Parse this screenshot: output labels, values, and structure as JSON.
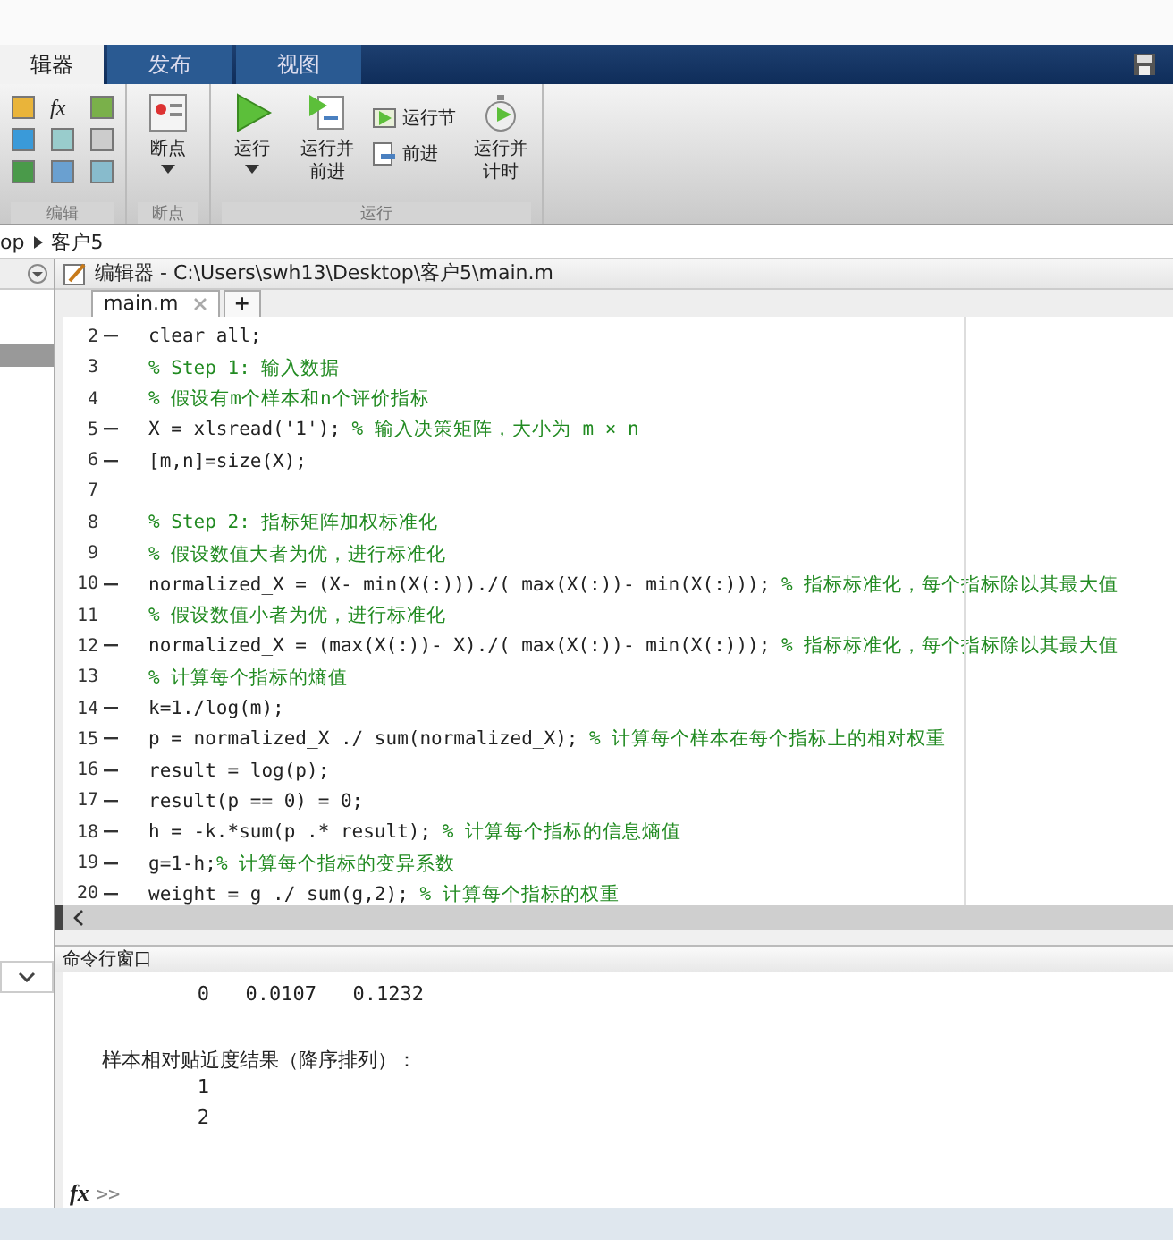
{
  "tabs": [
    {
      "label": "辑器",
      "selected": true
    },
    {
      "label": "发布",
      "selected": false
    },
    {
      "label": "视图",
      "selected": false
    }
  ],
  "ribbon": {
    "groups": [
      {
        "label": "编辑",
        "kind": "icons",
        "glyph": "fx"
      },
      {
        "label": "断点",
        "kind": "buttons",
        "items": [
          {
            "kind": "large",
            "label": "断点",
            "dropdown": true
          }
        ]
      },
      {
        "label": "运行",
        "kind": "buttons",
        "items": [
          {
            "kind": "large",
            "label": "运行",
            "dropdown": true
          },
          {
            "kind": "large",
            "label": "运行并前进",
            "dropdown": false
          },
          {
            "kind": "stack",
            "items": [
              {
                "label": "运行节"
              },
              {
                "label": "前进"
              }
            ]
          },
          {
            "kind": "large",
            "label": "运行并计时",
            "dropdown": false
          }
        ]
      }
    ]
  },
  "breadcrumb": [
    "op",
    "客户5"
  ],
  "editor": {
    "title": "编辑器 - C:\\Users\\swh13\\Desktop\\客户5\\main.m",
    "file_tabs": [
      {
        "label": "main.m",
        "selected": true
      }
    ],
    "add_tab": "+",
    "lines": [
      {
        "number": "2",
        "executable": true,
        "code": "clear all;"
      },
      {
        "number": "3",
        "executable": false,
        "comment": "% Step 1: 输入数据"
      },
      {
        "number": "4",
        "executable": false,
        "comment": "% 假设有m个样本和n个评价指标"
      },
      {
        "number": "5",
        "executable": true,
        "code": "X = xlsread('1'); ",
        "comment": "% 输入决策矩阵，大小为 m × n"
      },
      {
        "number": "6",
        "executable": true,
        "code": "[m,n]=size(X);"
      },
      {
        "number": "7",
        "executable": false
      },
      {
        "number": "8",
        "executable": false,
        "comment": "% Step 2: 指标矩阵加权标准化"
      },
      {
        "number": "9",
        "executable": false,
        "comment": "% 假设数值大者为优，进行标准化"
      },
      {
        "number": "10",
        "executable": true,
        "code": "normalized_X = (X- min(X(:)))./( max(X(:))- min(X(:))); ",
        "comment": "% 指标标准化，每个指标除以其最大值"
      },
      {
        "number": "11",
        "executable": false,
        "comment": "% 假设数值小者为优，进行标准化"
      },
      {
        "number": "12",
        "executable": true,
        "code": "normalized_X = (max(X(:))- X)./( max(X(:))- min(X(:))); ",
        "comment": "% 指标标准化，每个指标除以其最大值"
      },
      {
        "number": "13",
        "executable": false,
        "comment": "% 计算每个指标的熵值"
      },
      {
        "number": "14",
        "executable": true,
        "code": "k=1./log(m);"
      },
      {
        "number": "15",
        "executable": true,
        "code": "p = normalized_X ./ sum(normalized_X); ",
        "comment": "% 计算每个样本在每个指标上的相对权重"
      },
      {
        "number": "16",
        "executable": true,
        "code": "result = log(p);"
      },
      {
        "number": "17",
        "executable": true,
        "code": "result(p == 0) = 0;"
      },
      {
        "number": "18",
        "executable": true,
        "code": "h = -k.*sum(p .* result); ",
        "comment": "% 计算每个指标的信息熵值"
      },
      {
        "number": "19",
        "executable": true,
        "code": "g=1-h;",
        "comment": "% 计算每个指标的变异系数"
      },
      {
        "number": "20",
        "executable": true,
        "code": "weight = g ./ sum(g,2); ",
        "comment": "% 计算每个指标的权重"
      }
    ]
  },
  "command_window": {
    "title": "命令行窗口",
    "output": [
      {
        "kind": "row",
        "cells": [
          "0",
          "0.0107",
          "0.1232"
        ]
      },
      {
        "kind": "blank"
      },
      {
        "kind": "text",
        "text": "样本相对贴近度结果（降序排列）："
      },
      {
        "kind": "row",
        "cells": [
          "1"
        ]
      },
      {
        "kind": "row",
        "cells": [
          "2"
        ]
      }
    ],
    "function_button": "fx",
    "prompt": ">>"
  }
}
